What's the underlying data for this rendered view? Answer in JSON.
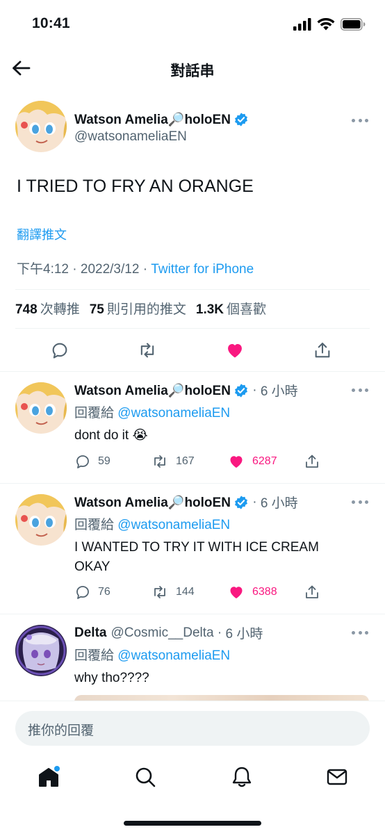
{
  "status_bar": {
    "time": "10:41"
  },
  "header": {
    "title": "對話串"
  },
  "main_tweet": {
    "display_name": "Watson Amelia🔎holoEN",
    "handle": "@watsonameliaEN",
    "text": "I TRIED TO FRY AN ORANGE",
    "translate": "翻譯推文",
    "time": "下午4:12",
    "date": "2022/3/12",
    "source": "Twitter for iPhone",
    "retweets_count": "748",
    "retweets_label": "次轉推",
    "quotes_count": "75",
    "quotes_label": "則引用的推文",
    "likes_count": "1.3K",
    "likes_label": "個喜歡"
  },
  "replies": [
    {
      "display_name": "Watson Amelia🔎holoEN",
      "handle": "",
      "time": "6 小時",
      "replying_label": "回覆給",
      "replying_to": "@watsonameliaEN",
      "text": "dont do it 😭",
      "comments": "59",
      "retweets": "167",
      "likes": "6287"
    },
    {
      "display_name": "Watson Amelia🔎holoEN",
      "handle": "",
      "time": "6 小時",
      "replying_label": "回覆給",
      "replying_to": "@watsonameliaEN",
      "text_line1": "I WANTED TO TRY IT WITH ICE CREAM",
      "text_line2": "OKAY",
      "comments": "76",
      "retweets": "144",
      "likes": "6388"
    },
    {
      "display_name": "Delta",
      "handle": "@Cosmic__Delta",
      "time": "6 小時",
      "replying_label": "回覆給",
      "replying_to": "@watsonameliaEN",
      "text": "why tho????"
    }
  ],
  "compose": {
    "placeholder": "推你的回覆"
  },
  "tabbar": {
    "items": [
      "home-icon",
      "search-icon",
      "bell-icon",
      "mail-icon"
    ]
  },
  "colors": {
    "accent": "#1d9bf0",
    "like": "#f91880",
    "muted": "#536471"
  }
}
